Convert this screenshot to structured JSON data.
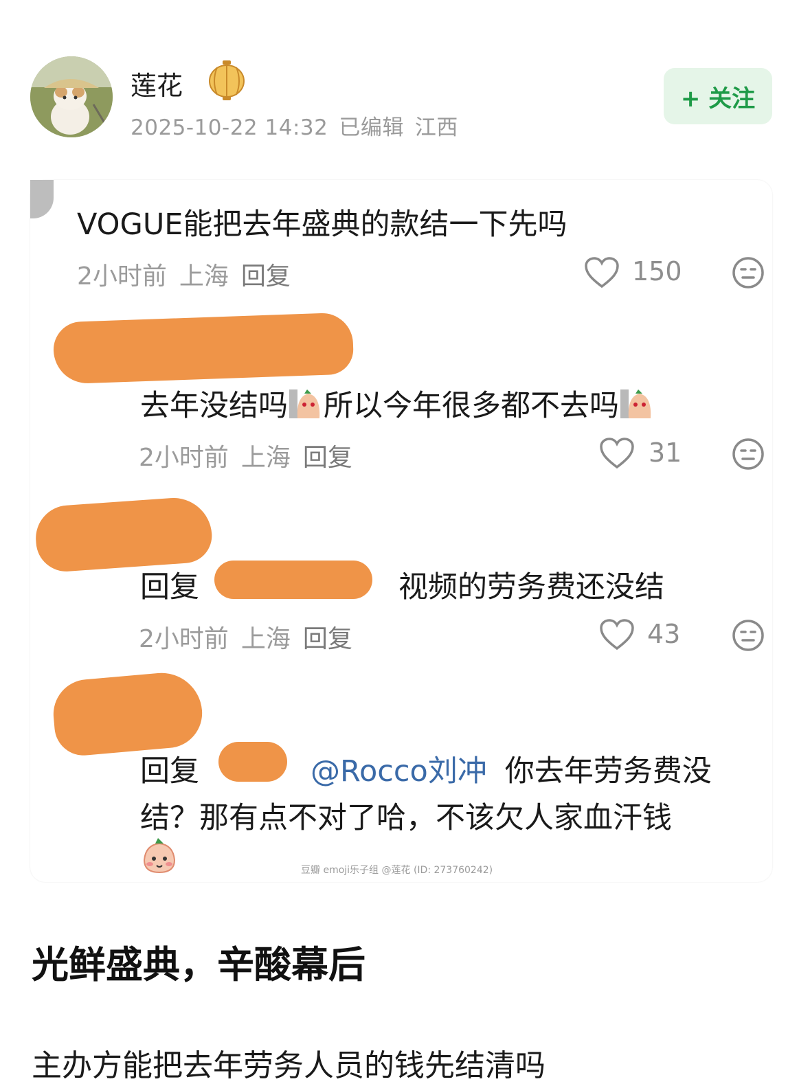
{
  "post": {
    "author": "莲花",
    "timestamp": "2025-10-22 14:32",
    "edited": "已编辑",
    "location": "江西",
    "follow_label": "+ 关注",
    "title": "光鲜盛典，辛酸幕后",
    "body": "主办方能把去年劳务人员的钱先结清吗"
  },
  "comments": [
    {
      "text": "VOGUE能把去年盛典的款结一下先吗",
      "time": "2小时前",
      "location": "上海",
      "reply_label": "回复",
      "likes": "150"
    },
    {
      "text_part1": "去年没结吗",
      "text_part2": "所以今年很多都不去吗",
      "time": "2小时前",
      "location": "上海",
      "reply_label": "回复",
      "likes": "31"
    },
    {
      "prefix": "回复",
      "text": "视频的劳务费还没结",
      "time": "2小时前",
      "location": "上海",
      "reply_label": "回复",
      "likes": "43"
    },
    {
      "prefix": "回复",
      "mention": "@Rocco刘冲",
      "line1": "你去年劳务费没",
      "line2": "结？那有点不对了哈，不该欠人家血汗钱"
    }
  ],
  "watermark": "豆瓣  emoji乐子组 @莲花 (ID: 273760242)",
  "icons": {
    "heart": "heart-icon",
    "emoji": "neutral-face-icon",
    "sticker": "peach-sticker-icon",
    "lantern": "lantern-badge-icon"
  },
  "colors": {
    "follow_bg": "#e5f5e8",
    "follow_text": "#1e9a47",
    "redaction": "#ef9448",
    "mention": "#3a6aa8"
  }
}
